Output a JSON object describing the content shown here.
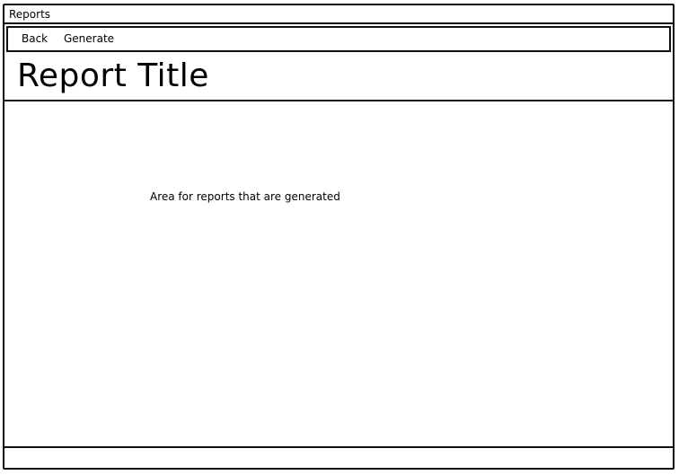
{
  "window": {
    "title": "Reports"
  },
  "toolbar": {
    "back_label": "Back",
    "generate_label": "Generate"
  },
  "header": {
    "title": "Report Title"
  },
  "main": {
    "placeholder": "Area for reports that are generated"
  },
  "colors": {
    "border": "#111111",
    "background": "#ffffff",
    "text": "#000000"
  }
}
